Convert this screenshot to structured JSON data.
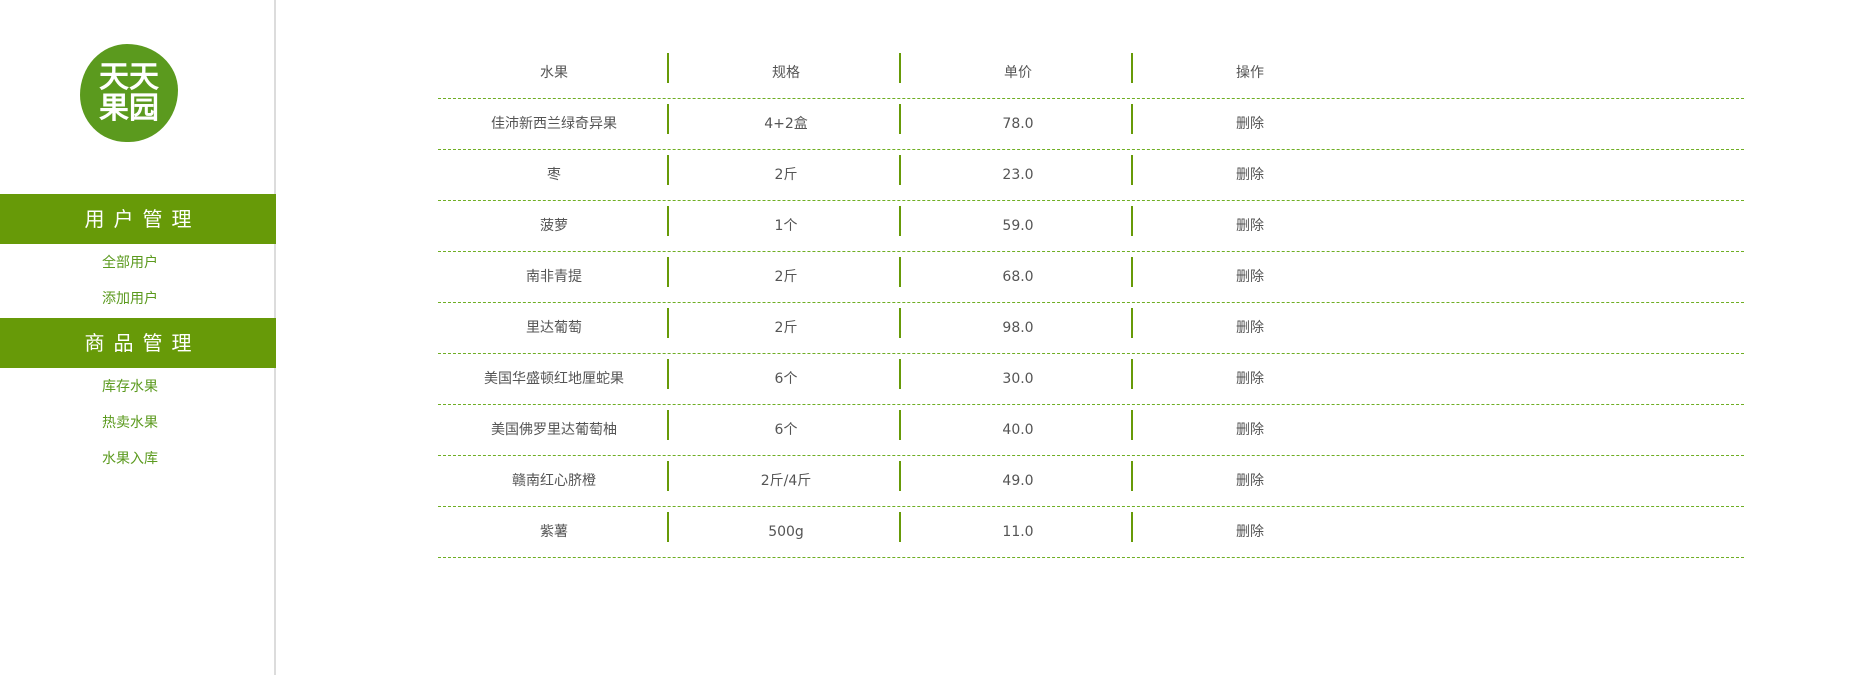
{
  "logo": {
    "text": "天天果园"
  },
  "sidebar": {
    "sections": [
      {
        "title": "用户管理",
        "items": [
          "全部用户",
          "添加用户"
        ]
      },
      {
        "title": "商品管理",
        "items": [
          "库存水果",
          "热卖水果",
          "水果入库"
        ]
      }
    ]
  },
  "table": {
    "headers": [
      "水果",
      "规格",
      "单价",
      "操作"
    ],
    "rows": [
      {
        "name": "佳沛新西兰绿奇异果",
        "spec": "4+2盒",
        "price": "78.0",
        "action": "删除"
      },
      {
        "name": "枣",
        "spec": "2斤",
        "price": "23.0",
        "action": "删除"
      },
      {
        "name": "菠萝",
        "spec": "1个",
        "price": "59.0",
        "action": "删除"
      },
      {
        "name": "南非青提",
        "spec": "2斤",
        "price": "68.0",
        "action": "删除"
      },
      {
        "name": "里达葡萄",
        "spec": "2斤",
        "price": "98.0",
        "action": "删除"
      },
      {
        "name": "美国华盛顿红地厘蛇果",
        "spec": "6个",
        "price": "30.0",
        "action": "删除"
      },
      {
        "name": "美国佛罗里达葡萄柚",
        "spec": "6个",
        "price": "40.0",
        "action": "删除"
      },
      {
        "name": "赣南红心脐橙",
        "spec": "2斤/4斤",
        "price": "49.0",
        "action": "删除"
      },
      {
        "name": "紫薯",
        "spec": "500g",
        "price": "11.0",
        "action": "删除"
      }
    ]
  },
  "colors": {
    "accent": "#679a08",
    "logo": "#5b9a1e",
    "link": "#5b9a1e",
    "text": "#555555",
    "divider": "#dcdcdc"
  }
}
